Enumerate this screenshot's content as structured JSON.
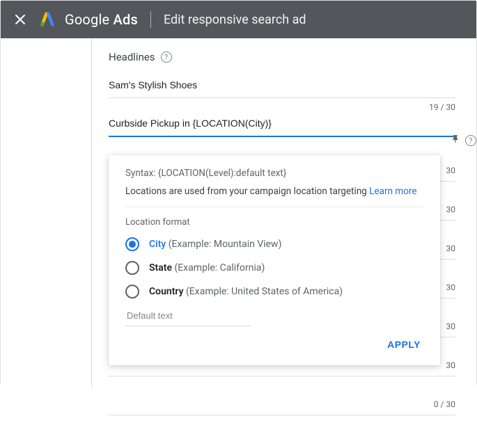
{
  "header": {
    "app_name_left": "Google",
    "app_name_right": "Ads",
    "page_title": "Edit responsive search ad"
  },
  "headlines": {
    "section_label": "Headlines",
    "items": [
      {
        "value": "Sam's Stylish Shoes"
      },
      {
        "value": "Curbside Pickup in {LOCATION(City)}",
        "count": "19 / 30",
        "active": true
      }
    ],
    "ghost_count": "30",
    "trailing_counts": [
      "30",
      "30",
      "30",
      "30",
      "30",
      "30",
      "0 / 30"
    ]
  },
  "popover": {
    "syntax": "Syntax: {LOCATION(Level):default text}",
    "description": "Locations are used from your campaign location targeting ",
    "learn_more": "Learn more",
    "group_label": "Location format",
    "options": [
      {
        "key": "city",
        "label": "City",
        "example": "(Example: Mountain View)",
        "selected": true
      },
      {
        "key": "state",
        "label": "State",
        "example": "(Example: California)",
        "selected": false
      },
      {
        "key": "country",
        "label": "Country",
        "example": "(Example: United States of America)",
        "selected": false
      }
    ],
    "default_text_placeholder": "Default text",
    "apply_label": "APPLY"
  }
}
